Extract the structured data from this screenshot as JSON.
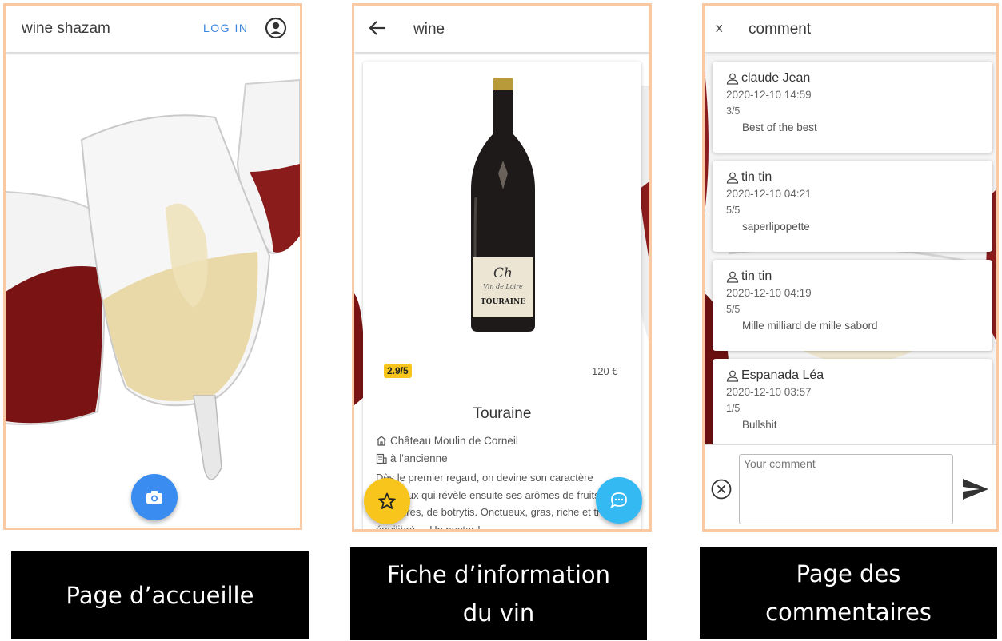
{
  "home": {
    "app_title": "wine shazam",
    "login_label": "LOG IN",
    "icons": {
      "account": "account-circle-icon",
      "camera": "camera-icon"
    },
    "caption": "Page d’accueille"
  },
  "wine_sheet": {
    "header_title": "wine",
    "rating": "2.9/5",
    "price": "120 €",
    "name": "Touraine",
    "producer": "Château Moulin de Corneil",
    "aging": "à l'ancienne",
    "description": "Dès le premier regard, on devine son caractère fougueux qui révèle ensuite ses arômes de fruits, de confitures, de botrytis. Onctueux, gras, riche et très équilibré.... Un nectar !",
    "bottle_label": {
      "line1": "Ch",
      "line2": "Vin de Loire",
      "appellation": "TOURAINE"
    },
    "colors": {
      "rating_badge": "#f7c51c",
      "favorite_fab": "#f7c51c",
      "comment_fab": "#35b9f3"
    },
    "icons": {
      "back": "arrow-back-icon",
      "producer": "home-icon",
      "aging": "barrel-icon",
      "favorite": "star-icon",
      "comments": "chat-bubble-icon"
    },
    "caption_line1": "Fiche d’information",
    "caption_line2": "du vin"
  },
  "comments_page": {
    "close_label": "x",
    "header_title": "comment",
    "comments": [
      {
        "user": "claude Jean",
        "date": "2020-12-10 14:59",
        "score": "3/5",
        "text": "Best of the best"
      },
      {
        "user": "tin tin",
        "date": "2020-12-10 04:21",
        "score": "5/5",
        "text": "saperlipopette"
      },
      {
        "user": "tin tin",
        "date": "2020-12-10 04:19",
        "score": "5/5",
        "text": "Mille milliard de mille sabord"
      },
      {
        "user": "Espanada Léa",
        "date": "2020-12-10 03:57",
        "score": "1/5",
        "text": "Bullshit"
      }
    ],
    "input_placeholder": "Your comment",
    "icons": {
      "clear": "clear-circle-icon",
      "send": "send-icon",
      "user": "person-icon"
    },
    "caption_line1": "Page des",
    "caption_line2": "commentaires"
  }
}
